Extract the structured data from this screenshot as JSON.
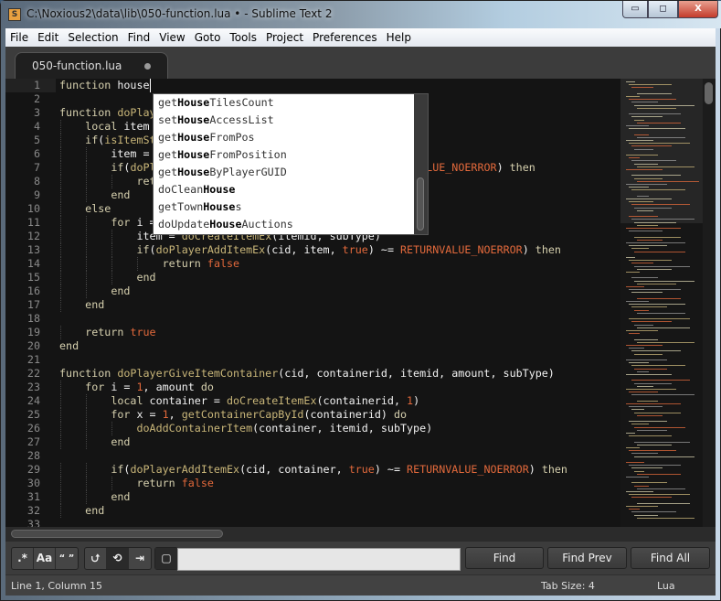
{
  "window": {
    "title": "C:\\Noxious2\\data\\lib\\050-function.lua • - Sublime Text 2",
    "controls": {
      "minimize": "▭",
      "maximize": "◻",
      "close": "X"
    }
  },
  "menu": [
    "File",
    "Edit",
    "Selection",
    "Find",
    "View",
    "Goto",
    "Tools",
    "Project",
    "Preferences",
    "Help"
  ],
  "tab": {
    "label": "050-function.lua",
    "modified": true
  },
  "colors": {
    "keyword": "#d6d0ae",
    "function": "#c9b679",
    "constant": "#e2693b",
    "text": "#f2f2f2",
    "background": "#141414"
  },
  "editor": {
    "lines": [
      {
        "n": "1",
        "indent": 0,
        "seg": [
          [
            "k",
            "function"
          ],
          [
            "t",
            " house"
          ]
        ]
      },
      {
        "n": "2",
        "indent": 0,
        "seg": []
      },
      {
        "n": "3",
        "indent": 0,
        "seg": [
          [
            "k",
            "function"
          ],
          [
            "t",
            " "
          ],
          [
            "f",
            "doPlayerGiveItem"
          ],
          [
            "t",
            "(cid, itemid, amount, subType)"
          ]
        ]
      },
      {
        "n": "4",
        "indent": 1,
        "seg": [
          [
            "k",
            "local"
          ],
          [
            "t",
            " item = "
          ],
          [
            "c",
            "0"
          ]
        ]
      },
      {
        "n": "5",
        "indent": 1,
        "seg": [
          [
            "k",
            "if"
          ],
          [
            "t",
            "("
          ],
          [
            "f",
            "isItemStackable"
          ],
          [
            "t",
            "(itemid)) "
          ],
          [
            "k",
            "then"
          ]
        ]
      },
      {
        "n": "6",
        "indent": 2,
        "seg": [
          [
            "t",
            "item = "
          ],
          [
            "f",
            "doCreateItemEx"
          ],
          [
            "t",
            "(itemid, amount)"
          ]
        ]
      },
      {
        "n": "7",
        "indent": 2,
        "seg": [
          [
            "k",
            "if"
          ],
          [
            "t",
            "("
          ],
          [
            "f",
            "doPlayerAddItemEx"
          ],
          [
            "t",
            "(cid, item, "
          ],
          [
            "c",
            "true"
          ],
          [
            "t",
            ") ~= "
          ],
          [
            "c",
            "RETURNVALUE_NOERROR"
          ],
          [
            "t",
            ") "
          ],
          [
            "k",
            "then"
          ]
        ]
      },
      {
        "n": "8",
        "indent": 3,
        "seg": [
          [
            "k",
            "return"
          ],
          [
            "t",
            " "
          ],
          [
            "c",
            "false"
          ]
        ]
      },
      {
        "n": "9",
        "indent": 2,
        "seg": [
          [
            "k",
            "end"
          ]
        ]
      },
      {
        "n": "10",
        "indent": 1,
        "seg": [
          [
            "k",
            "else"
          ]
        ]
      },
      {
        "n": "11",
        "indent": 2,
        "seg": [
          [
            "k",
            "for"
          ],
          [
            "t",
            " i = "
          ],
          [
            "c",
            "1"
          ],
          [
            "t",
            ", amount "
          ],
          [
            "k",
            "do"
          ]
        ]
      },
      {
        "n": "12",
        "indent": 3,
        "seg": [
          [
            "t",
            "item = "
          ],
          [
            "f",
            "doCreateItemEx"
          ],
          [
            "t",
            "(itemid, subType)"
          ]
        ]
      },
      {
        "n": "13",
        "indent": 3,
        "seg": [
          [
            "k",
            "if"
          ],
          [
            "t",
            "("
          ],
          [
            "f",
            "doPlayerAddItemEx"
          ],
          [
            "t",
            "(cid, item, "
          ],
          [
            "c",
            "true"
          ],
          [
            "t",
            ") ~= "
          ],
          [
            "c",
            "RETURNVALUE_NOERROR"
          ],
          [
            "t",
            ") "
          ],
          [
            "k",
            "then"
          ]
        ]
      },
      {
        "n": "14",
        "indent": 4,
        "seg": [
          [
            "k",
            "return"
          ],
          [
            "t",
            " "
          ],
          [
            "c",
            "false"
          ]
        ]
      },
      {
        "n": "15",
        "indent": 3,
        "seg": [
          [
            "k",
            "end"
          ]
        ]
      },
      {
        "n": "16",
        "indent": 2,
        "seg": [
          [
            "k",
            "end"
          ]
        ]
      },
      {
        "n": "17",
        "indent": 1,
        "seg": [
          [
            "k",
            "end"
          ]
        ]
      },
      {
        "n": "18",
        "indent": 0,
        "seg": []
      },
      {
        "n": "19",
        "indent": 1,
        "seg": [
          [
            "k",
            "return"
          ],
          [
            "t",
            " "
          ],
          [
            "c",
            "true"
          ]
        ]
      },
      {
        "n": "20",
        "indent": 0,
        "seg": [
          [
            "k",
            "end"
          ]
        ]
      },
      {
        "n": "21",
        "indent": 0,
        "seg": []
      },
      {
        "n": "22",
        "indent": 0,
        "seg": [
          [
            "k",
            "function"
          ],
          [
            "t",
            " "
          ],
          [
            "f",
            "doPlayerGiveItemContainer"
          ],
          [
            "t",
            "(cid, containerid, itemid, amount, subType)"
          ]
        ]
      },
      {
        "n": "23",
        "indent": 1,
        "seg": [
          [
            "k",
            "for"
          ],
          [
            "t",
            " i = "
          ],
          [
            "c",
            "1"
          ],
          [
            "t",
            ", amount "
          ],
          [
            "k",
            "do"
          ]
        ]
      },
      {
        "n": "24",
        "indent": 2,
        "seg": [
          [
            "k",
            "local"
          ],
          [
            "t",
            " container = "
          ],
          [
            "f",
            "doCreateItemEx"
          ],
          [
            "t",
            "(containerid, "
          ],
          [
            "c",
            "1"
          ],
          [
            "t",
            ")"
          ]
        ]
      },
      {
        "n": "25",
        "indent": 2,
        "seg": [
          [
            "k",
            "for"
          ],
          [
            "t",
            " x = "
          ],
          [
            "c",
            "1"
          ],
          [
            "t",
            ", "
          ],
          [
            "f",
            "getContainerCapById"
          ],
          [
            "t",
            "(containerid) "
          ],
          [
            "k",
            "do"
          ]
        ]
      },
      {
        "n": "26",
        "indent": 3,
        "seg": [
          [
            "f",
            "doAddContainerItem"
          ],
          [
            "t",
            "(container, itemid, subType)"
          ]
        ]
      },
      {
        "n": "27",
        "indent": 2,
        "seg": [
          [
            "k",
            "end"
          ]
        ]
      },
      {
        "n": "28",
        "indent": 0,
        "seg": []
      },
      {
        "n": "29",
        "indent": 2,
        "seg": [
          [
            "k",
            "if"
          ],
          [
            "t",
            "("
          ],
          [
            "f",
            "doPlayerAddItemEx"
          ],
          [
            "t",
            "(cid, container, "
          ],
          [
            "c",
            "true"
          ],
          [
            "t",
            ") ~= "
          ],
          [
            "c",
            "RETURNVALUE_NOERROR"
          ],
          [
            "t",
            ") "
          ],
          [
            "k",
            "then"
          ]
        ]
      },
      {
        "n": "30",
        "indent": 3,
        "seg": [
          [
            "k",
            "return"
          ],
          [
            "t",
            " "
          ],
          [
            "c",
            "false"
          ]
        ]
      },
      {
        "n": "31",
        "indent": 2,
        "seg": [
          [
            "k",
            "end"
          ]
        ]
      },
      {
        "n": "32",
        "indent": 1,
        "seg": [
          [
            "k",
            "end"
          ]
        ]
      },
      {
        "n": "33",
        "indent": 0,
        "seg": []
      }
    ]
  },
  "autocomplete": [
    [
      "get",
      "House",
      "TilesCount"
    ],
    [
      "set",
      "House",
      "AccessList"
    ],
    [
      "get",
      "House",
      "FromPos"
    ],
    [
      "get",
      "House",
      "FromPosition"
    ],
    [
      "get",
      "House",
      "ByPlayerGUID"
    ],
    [
      "doClean",
      "House",
      ""
    ],
    [
      "getTown",
      "House",
      "s"
    ],
    [
      "doUpdate",
      "House",
      "Auctions"
    ]
  ],
  "find_panel": {
    "toggles": [
      ".*",
      "Aa",
      "“ ”",
      "⮍",
      "⟲",
      "⇥",
      "▢"
    ],
    "input_value": "",
    "find": "Find",
    "find_prev": "Find Prev",
    "find_all": "Find All"
  },
  "status": {
    "position": "Line 1, Column 15",
    "tab_size": "Tab Size: 4",
    "syntax": "Lua"
  }
}
